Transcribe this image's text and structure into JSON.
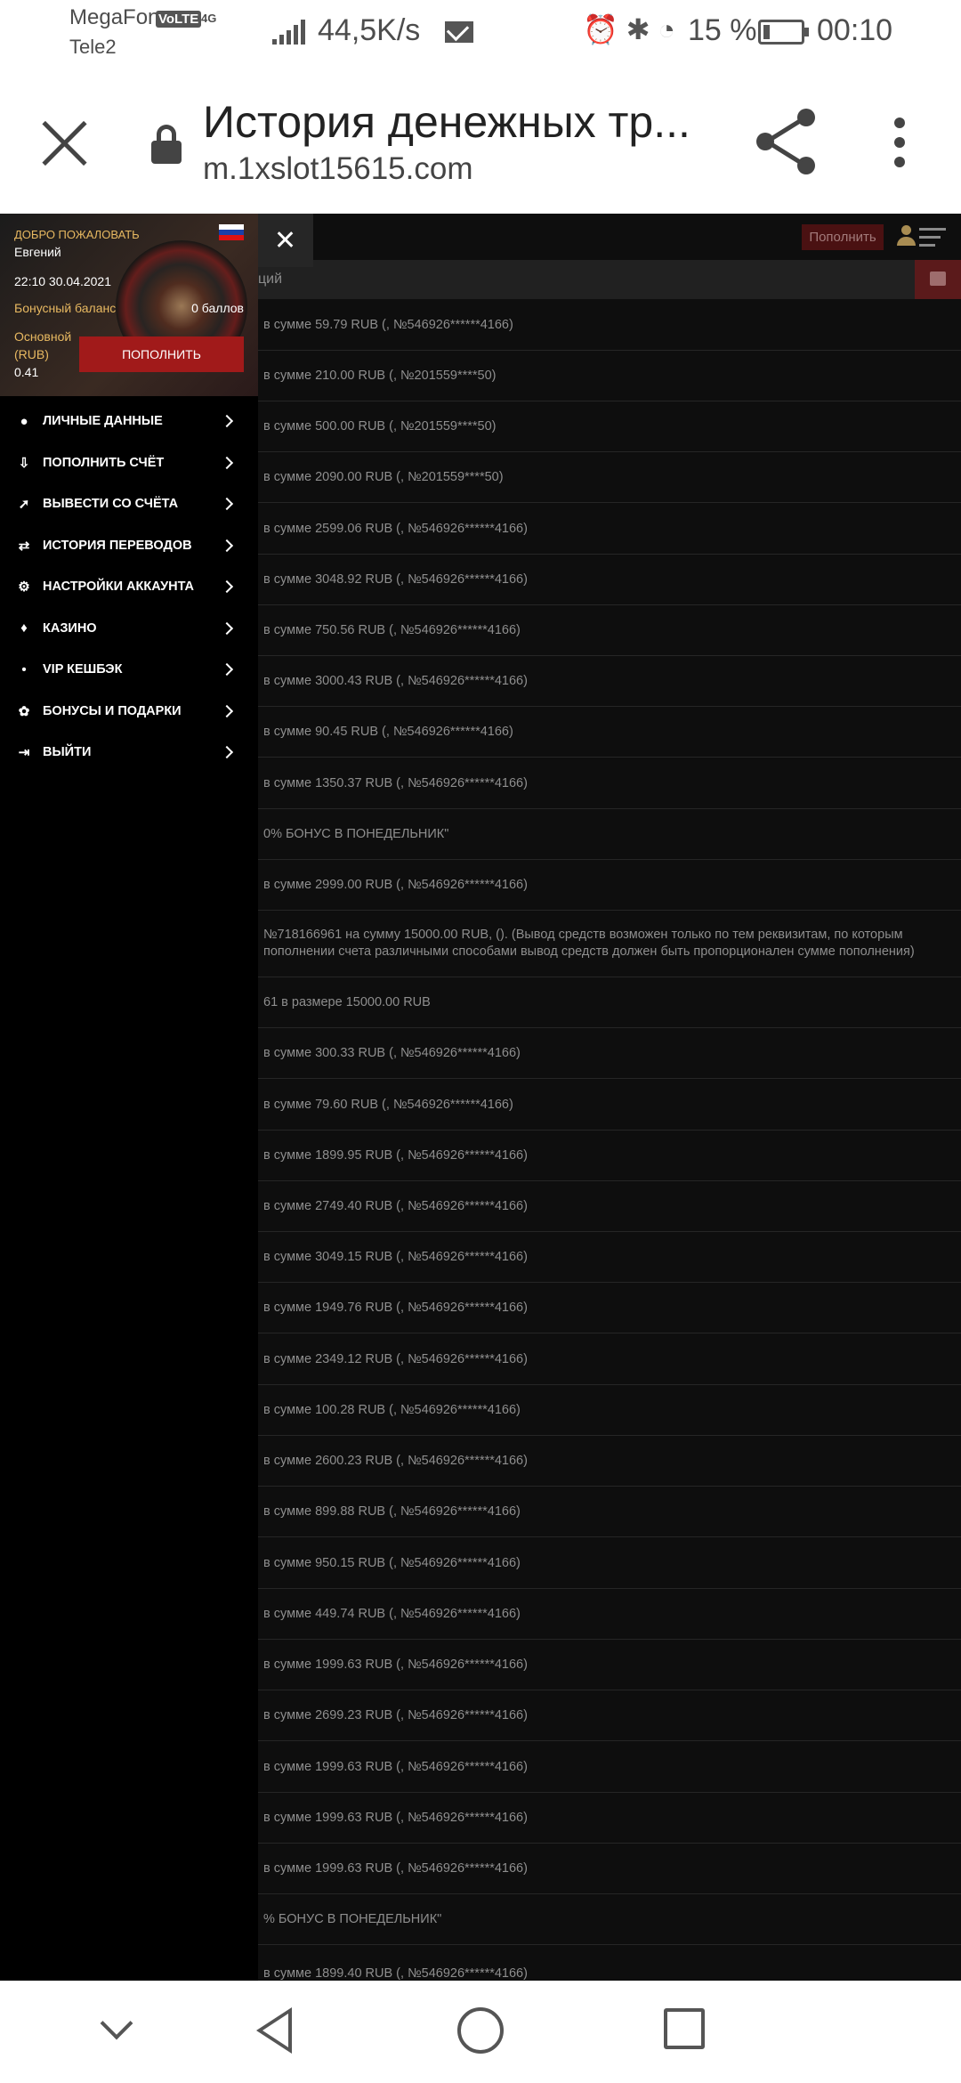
{
  "status": {
    "operator1": "MegaFon",
    "volte": "VoLTE",
    "operator2": "Tele2",
    "network": "4G",
    "speed": "44,5K/s",
    "battery": "15 %",
    "time": "00:10"
  },
  "browser": {
    "title": "История денежных тр...",
    "url": "m.1xslot15615.com"
  },
  "site": {
    "topup_label": "Пополнить",
    "section_title": "ций"
  },
  "drawer": {
    "welcome": "ДОБРО ПОЖАЛОВАТЬ",
    "user": "Евгений",
    "datetime": "22:10 30.04.2021",
    "bonus_label": "Бонусный баланс",
    "bonus_value": "0 баллов",
    "main_label": "Основной (RUB)",
    "main_value": "0.41",
    "topup_button": "ПОПОЛНИТЬ",
    "items": [
      {
        "label": "ЛИЧНЫЕ ДАННЫЕ",
        "icon": "user-icon"
      },
      {
        "label": "ПОПОЛНИТЬ СЧЁТ",
        "icon": "deposit-icon"
      },
      {
        "label": "ВЫВЕСТИ СО СЧЁТА",
        "icon": "withdraw-icon"
      },
      {
        "label": "ИСТОРИЯ ПЕРЕВОДОВ",
        "icon": "transfer-icon"
      },
      {
        "label": "НАСТРОЙКИ АККАУНТА",
        "icon": "gear-icon"
      },
      {
        "label": "КАЗИНО",
        "icon": "casino-icon"
      },
      {
        "label": "VIP КЕШБЭК",
        "icon": "dot-icon"
      },
      {
        "label": "БОНУСЫ И ПОДАРКИ",
        "icon": "gift-icon"
      },
      {
        "label": "ВЫЙТИ",
        "icon": "logout-icon"
      }
    ]
  },
  "rows": [
    "в сумме 59.79 RUB (, №546926******4166)",
    "в сумме 210.00 RUB (, №201559****50)",
    "в сумме 500.00 RUB (, №201559****50)",
    "в сумме 2090.00 RUB (, №201559****50)",
    "в сумме 2599.06 RUB (, №546926******4166)",
    "в сумме 3048.92 RUB (, №546926******4166)",
    "в сумме 750.56 RUB (, №546926******4166)",
    "в сумме 3000.43 RUB (, №546926******4166)",
    "в сумме 90.45 RUB (, №546926******4166)",
    "в сумме 1350.37 RUB (, №546926******4166)",
    "0% БОНУС В ПОНЕДЕЛЬНИК\"",
    "в сумме 2999.00 RUB (, №546926******4166)",
    "№718166961 на сумму 15000.00 RUB, (). (Вывод средств возможен только по тем реквизитам, по которым пополнении счета различными способами вывод средств должен быть пропорционален сумме пополнения)",
    "61 в размере 15000.00 RUB",
    "в сумме 300.33 RUB (, №546926******4166)",
    "в сумме 79.60 RUB (, №546926******4166)",
    "в сумме 1899.95 RUB (, №546926******4166)",
    "в сумме 2749.40 RUB (, №546926******4166)",
    "в сумме 3049.15 RUB (, №546926******4166)",
    "в сумме 1949.76 RUB (, №546926******4166)",
    "в сумме 2349.12 RUB (, №546926******4166)",
    "в сумме 100.28 RUB (, №546926******4166)",
    "в сумме 2600.23 RUB (, №546926******4166)",
    "в сумме 899.88 RUB (, №546926******4166)",
    "в сумме 950.15 RUB (, №546926******4166)",
    "в сумме 449.74 RUB (, №546926******4166)",
    "в сумме 1999.63 RUB (, №546926******4166)",
    "в сумме 2699.23 RUB (, №546926******4166)",
    "в сумме 1999.63 RUB (, №546926******4166)",
    "в сумме 1999.63 RUB (, №546926******4166)",
    "в сумме 1999.63 RUB (, №546926******4166)",
    "% БОНУС В ПОНЕДЕЛЬНИК\"",
    "в сумме 1899.40 RUB (, №546926******4166)"
  ]
}
